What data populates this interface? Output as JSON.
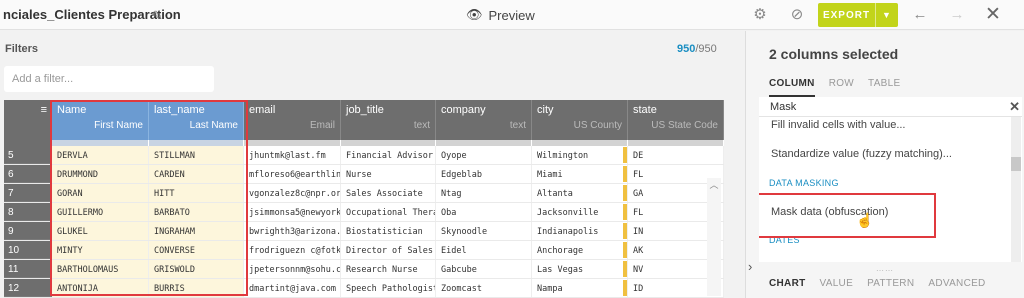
{
  "topbar": {
    "title": "nciales_Clientes Preparation",
    "preview_label": "Preview",
    "export_label": "EXPORT"
  },
  "filters": {
    "label": "Filters",
    "count_shown": "950",
    "count_total": "/950",
    "add_placeholder": "Add a filter..."
  },
  "grid": {
    "columns": [
      {
        "name": "Name",
        "type": "First Name",
        "selected": true
      },
      {
        "name": "last_name",
        "type": "Last Name",
        "selected": true
      },
      {
        "name": "email",
        "type": "Email",
        "selected": false
      },
      {
        "name": "job_title",
        "type": "text",
        "selected": false
      },
      {
        "name": "company",
        "type": "text",
        "selected": false
      },
      {
        "name": "city",
        "type": "US County",
        "selected": false
      },
      {
        "name": "state",
        "type": "US State Code",
        "selected": false
      }
    ],
    "rows": [
      [
        "5",
        "DERVLA",
        "STILLMAN",
        "jhuntmk@last.fm",
        "Financial Advisor",
        "Oyope",
        "Wilmington",
        "DE"
      ],
      [
        "6",
        "DRUMMOND",
        "CARDEN",
        "mfloreso6@earthlink.net",
        "Nurse",
        "Edgeblab",
        "Miami",
        "FL"
      ],
      [
        "7",
        "GORAN",
        "HITT",
        "vgonzalez8c@npr.org",
        "Sales Associate",
        "Ntag",
        "Altanta",
        "GA"
      ],
      [
        "8",
        "GUILLERMO",
        "BARBATO",
        "jsimmonsa5@newyorker.com",
        "Occupational Therapist",
        "Oba",
        "Jacksonville",
        "FL"
      ],
      [
        "9",
        "GLUKEL",
        "INGRAHAM",
        "bwrighth3@arizona.edu",
        "Biostatistician",
        "Skynoodle",
        "Indianapolis",
        "IN"
      ],
      [
        "10",
        "MINTY",
        "CONVERSE",
        "frodriguezn c@fotki.com",
        "Director of Sales",
        "Eidel",
        "Anchorage",
        "AK"
      ],
      [
        "11",
        "BARTHOLOMAUS",
        "GRISWOLD",
        "jpetersonnm@sohu.com",
        "Research Nurse",
        "Gabcube",
        "Las Vegas",
        "NV"
      ],
      [
        "12",
        "ANTONIJA",
        "BURRIS",
        "dmartint@java.com",
        "Speech Pathologist",
        "Zoomcast",
        "Nampa",
        "ID"
      ]
    ]
  },
  "panel": {
    "selection_title": "2 columns selected",
    "tabs": [
      "COLUMN",
      "ROW",
      "TABLE"
    ],
    "search_value": "Mask",
    "items": {
      "fill_invalid": "Fill invalid cells with value...",
      "standardize": "Standardize value (fuzzy matching)...",
      "category_masking": "DATA MASKING",
      "mask_data": "Mask data (obfuscation)",
      "category_dates": "DATES"
    },
    "bottom_tabs": [
      "CHART",
      "VALUE",
      "PATTERN",
      "ADVANCED"
    ]
  }
}
